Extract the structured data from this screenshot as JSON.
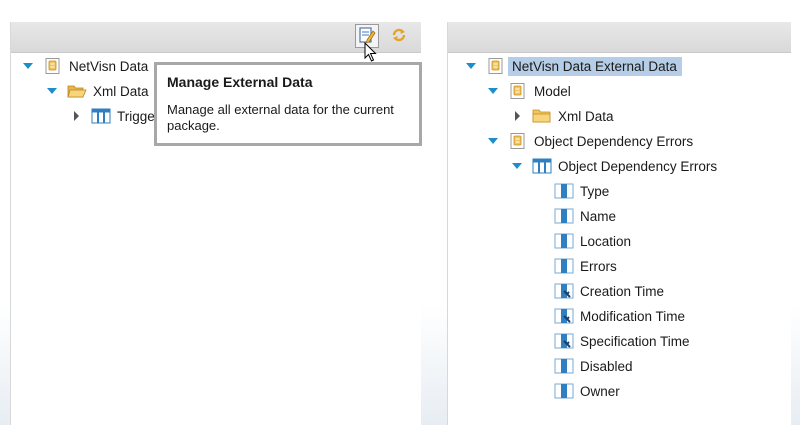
{
  "colors": {
    "accent": "#1d8ecb",
    "selection": "#b5cde6",
    "folder": "#f2c45a",
    "grid_blue": "#2f7fc1"
  },
  "left_panel": {
    "toolbar": {
      "buttons": [
        {
          "icon": "manage-external-data-icon",
          "pressed": true
        },
        {
          "icon": "refresh-icon",
          "pressed": false
        }
      ]
    },
    "tree": [
      {
        "label": "NetVisn Data",
        "icon": "data-source-icon",
        "state": "expanded"
      },
      {
        "label": "Xml Data",
        "icon": "folder-open-icon",
        "state": "expanded"
      },
      {
        "label": "Trigge",
        "icon": "table-icon",
        "state": "collapsed"
      }
    ]
  },
  "tooltip": {
    "title": "Manage External Data",
    "body": "Manage all external data for the current package."
  },
  "right_panel": {
    "tree": [
      {
        "label": "NetVisn Data External Data",
        "icon": "data-source-icon",
        "state": "expanded",
        "selected": true
      },
      {
        "label": "Model",
        "icon": "data-source-icon",
        "state": "expanded"
      },
      {
        "label": "Xml Data",
        "icon": "folder-icon",
        "state": "collapsed"
      },
      {
        "label": "Object Dependency Errors",
        "icon": "data-source-icon",
        "state": "expanded"
      },
      {
        "label": "Object Dependency Errors",
        "icon": "table-icon",
        "state": "expanded"
      },
      {
        "label": "Type",
        "icon": "column-icon"
      },
      {
        "label": "Name",
        "icon": "column-icon"
      },
      {
        "label": "Location",
        "icon": "column-icon"
      },
      {
        "label": "Errors",
        "icon": "column-icon"
      },
      {
        "label": "Creation Time",
        "icon": "key-column-icon"
      },
      {
        "label": "Modification Time",
        "icon": "key-column-icon"
      },
      {
        "label": "Specification Time",
        "icon": "key-column-icon"
      },
      {
        "label": "Disabled",
        "icon": "column-icon"
      },
      {
        "label": "Owner",
        "icon": "column-icon"
      }
    ]
  }
}
